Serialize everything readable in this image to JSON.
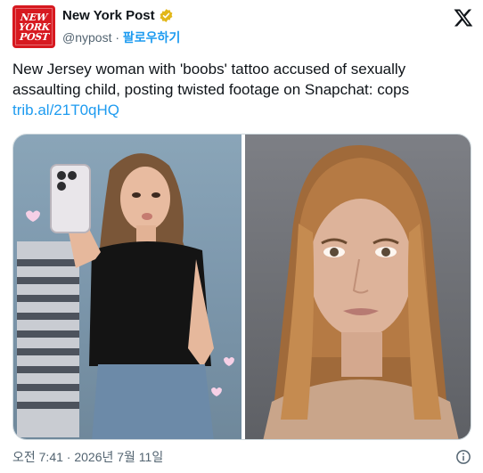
{
  "account": {
    "name": "New York Post",
    "handle": "@nypost",
    "separator": " · ",
    "follow_label": "팔로우하기",
    "logo_lines": [
      "NEW",
      "YORK",
      "POST"
    ]
  },
  "tweet": {
    "text": "New Jersey woman with 'boobs' tattoo accused of sexually assaulting child, posting twisted footage on Snapchat: cops ",
    "link": "trib.al/21T0qHQ"
  },
  "timestamp": "오전 7:41 · 2026년 7월 11일",
  "icons": {
    "verified": "verified-badge-icon",
    "x_logo": "x-logo-icon",
    "info": "info-icon"
  },
  "colors": {
    "accent": "#1d9bf0",
    "verified_gold": "#e2b719",
    "brand_red": "#d71920",
    "text": "#0f1419",
    "muted": "#536471"
  }
}
